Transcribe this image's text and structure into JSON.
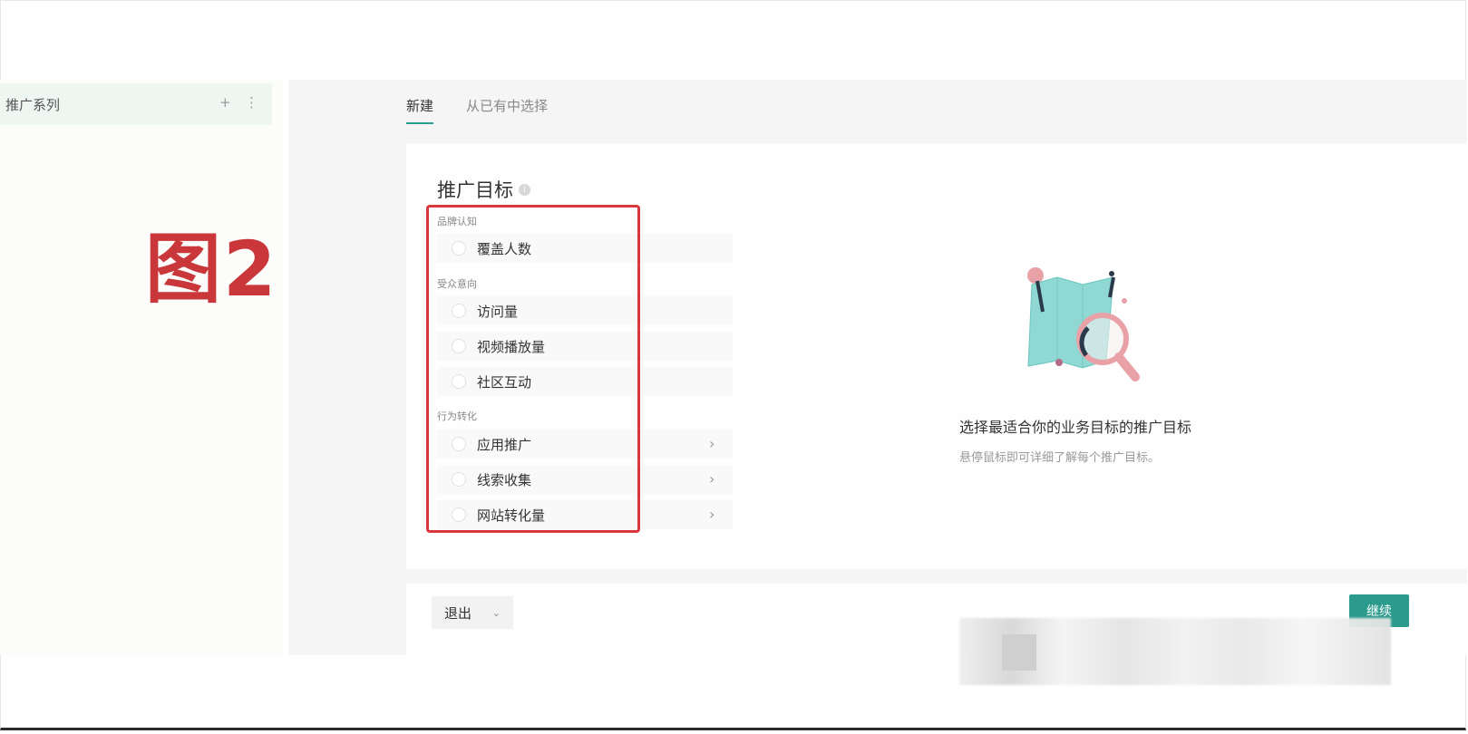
{
  "sidebar": {
    "item_label": "推广系列",
    "plus": "+",
    "more": "⋮"
  },
  "annotation": "图2",
  "tabs": [
    {
      "label": "新建",
      "active": true
    },
    {
      "label": "从已有中选择",
      "active": false
    }
  ],
  "objective": {
    "title": "推广目标",
    "groups": [
      {
        "label": "品牌认知",
        "options": [
          "覆盖人数"
        ]
      },
      {
        "label": "受众意向",
        "options": [
          "访问量",
          "视频播放量",
          "社区互动"
        ]
      },
      {
        "label": "行为转化",
        "options": [
          "应用推广",
          "线索收集",
          "网站转化量"
        ]
      }
    ]
  },
  "side_panel": {
    "title": "选择最适合你的业务目标的推广目标",
    "subtitle": "悬停鼠标即可详细了解每个推广目标。"
  },
  "footer": {
    "exit_label": "退出",
    "continue_label": "继续"
  },
  "colors": {
    "accent": "#2a9b8c",
    "annotation_red": "#d8383b"
  }
}
